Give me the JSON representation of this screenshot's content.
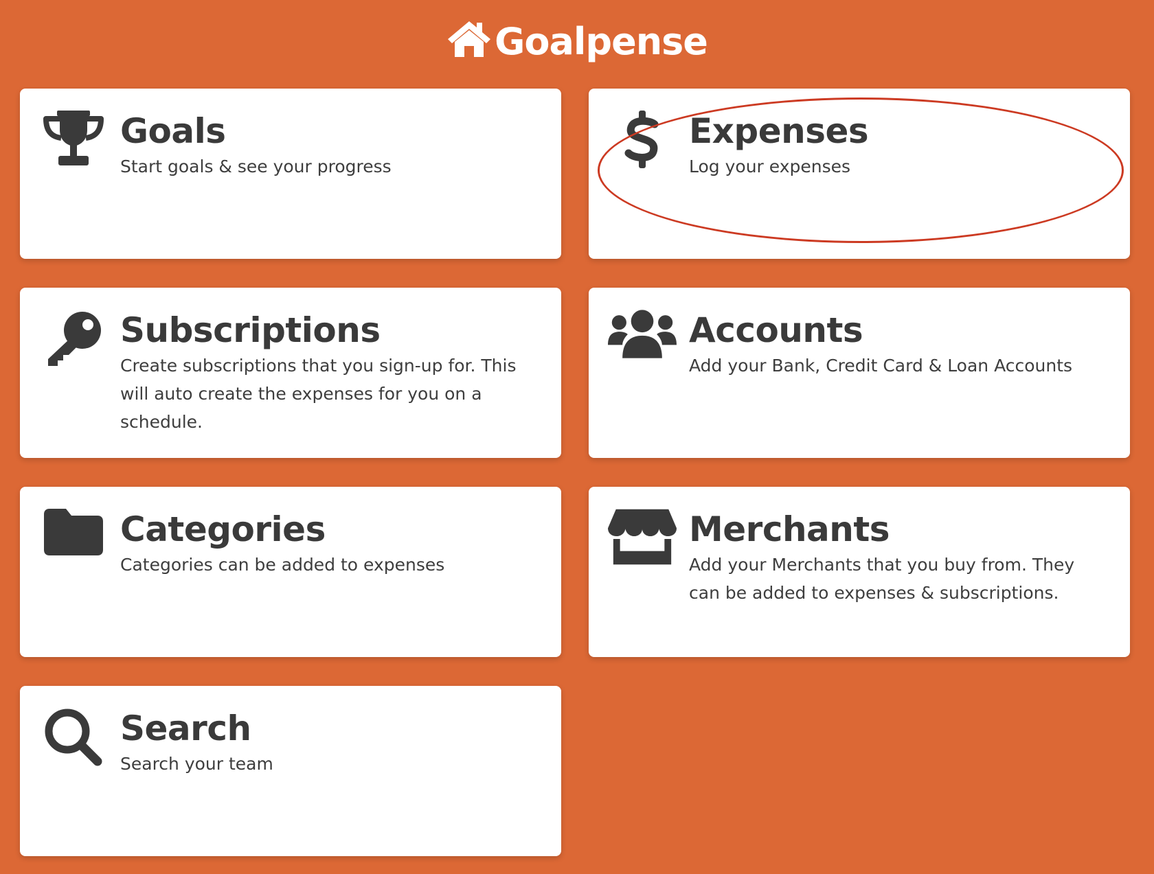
{
  "app": {
    "title": "Goalpense",
    "logo_icon": "home-icon",
    "background_color": "#dc6835"
  },
  "cards": {
    "goals": {
      "title": "Goals",
      "description": "Start goals & see your progress",
      "icon": "trophy-icon"
    },
    "expenses": {
      "title": "Expenses",
      "description": "Log your expenses",
      "icon": "dollar-icon"
    },
    "subscriptions": {
      "title": "Subscriptions",
      "description": "Create subscriptions that you sign-up for. This will auto create the expenses for you on a schedule.",
      "icon": "key-icon"
    },
    "accounts": {
      "title": "Accounts",
      "description": "Add your Bank, Credit Card & Loan Accounts",
      "icon": "users-icon"
    },
    "categories": {
      "title": "Categories",
      "description": "Categories can be added to expenses",
      "icon": "folder-icon"
    },
    "merchants": {
      "title": "Merchants",
      "description": "Add your Merchants that you buy from. They can be added to expenses & subscriptions.",
      "icon": "store-icon"
    },
    "search": {
      "title": "Search",
      "description": "Search your team",
      "icon": "search-icon"
    }
  },
  "annotation": {
    "highlight_color": "#cc3a22"
  }
}
